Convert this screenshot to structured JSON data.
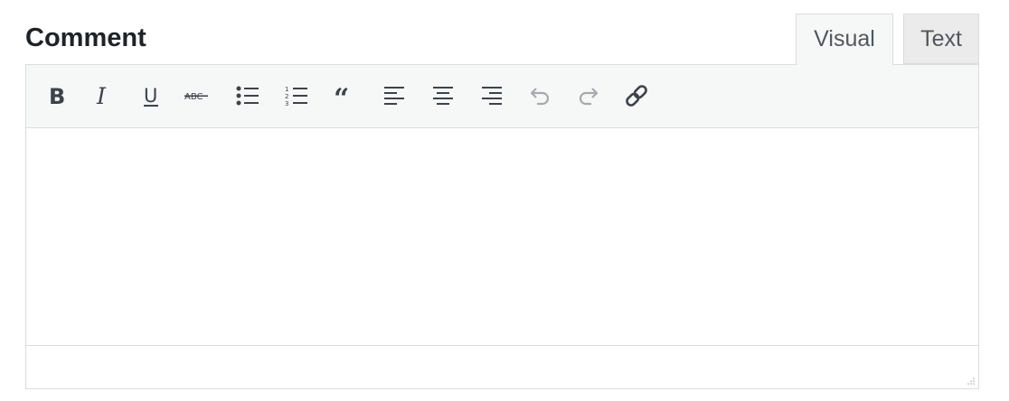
{
  "field": {
    "label": "Comment"
  },
  "tabs": [
    {
      "label": "Visual",
      "active": true
    },
    {
      "label": "Text",
      "active": false
    }
  ],
  "toolbar": {
    "buttons": [
      {
        "name": "bold",
        "icon": "bold-icon"
      },
      {
        "name": "italic",
        "icon": "italic-icon"
      },
      {
        "name": "underline",
        "icon": "underline-icon"
      },
      {
        "name": "strikethrough",
        "icon": "strikethrough-icon"
      },
      {
        "name": "bulleted-list",
        "icon": "bulleted-list-icon"
      },
      {
        "name": "numbered-list",
        "icon": "numbered-list-icon"
      },
      {
        "name": "blockquote",
        "icon": "blockquote-icon"
      },
      {
        "name": "align-left",
        "icon": "align-left-icon"
      },
      {
        "name": "align-center",
        "icon": "align-center-icon"
      },
      {
        "name": "align-right",
        "icon": "align-right-icon"
      },
      {
        "name": "undo",
        "icon": "undo-icon",
        "disabled": true
      },
      {
        "name": "redo",
        "icon": "redo-icon",
        "disabled": true
      },
      {
        "name": "link",
        "icon": "link-icon"
      }
    ],
    "strike_text": "ABC"
  },
  "editor": {
    "content": ""
  },
  "colors": {
    "border": "#dcdcde",
    "toolbar_bg": "#f6f7f7",
    "icon": "#3c434a",
    "icon_disabled": "#a7aaad",
    "label": "#1d2327"
  }
}
